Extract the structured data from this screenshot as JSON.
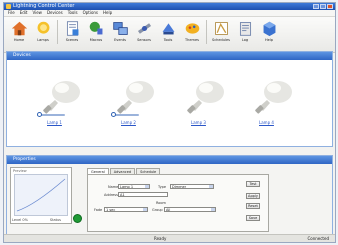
{
  "window": {
    "title": "Lightning Control Center"
  },
  "menu": [
    "File",
    "Edit",
    "View",
    "Devices",
    "Tools",
    "Options",
    "Help"
  ],
  "toolbar": [
    {
      "icon": "house-icon",
      "label": "Home"
    },
    {
      "icon": "light-icon",
      "label": "Lamps"
    },
    {
      "icon": "document-icon",
      "label": "Scenes"
    },
    {
      "icon": "plant-icon",
      "label": "Macros"
    },
    {
      "icon": "network-icon",
      "label": "Events"
    },
    {
      "icon": "satellite-icon",
      "label": "Sensors"
    },
    {
      "icon": "tools-icon",
      "label": "Tools"
    },
    {
      "icon": "palette-icon",
      "label": "Themes"
    },
    {
      "icon": "book-icon",
      "label": "Schedules"
    },
    {
      "icon": "clipboard-icon",
      "label": "Log"
    },
    {
      "icon": "cube-icon",
      "label": "Help"
    }
  ],
  "devices_panel": {
    "title": "Devices"
  },
  "devices": [
    {
      "name": "Lamp 1"
    },
    {
      "name": "Lamp 2"
    },
    {
      "name": "Lamp 3"
    },
    {
      "name": "Lamp 4"
    }
  ],
  "properties_panel": {
    "title": "Properties",
    "preview_label": "Preview",
    "preview_left": "Level 0%",
    "preview_right": "Status",
    "tabs": [
      "General",
      "Advanced",
      "Schedule"
    ],
    "fields": {
      "name_label": "Name",
      "name_value": "Lamp 1",
      "type_label": "Type",
      "type_value": "Dimmer",
      "address_label": "Address",
      "address_value": "A1",
      "room_label": "Room",
      "room_value": "Living",
      "fade_label": "Fade",
      "fade_value": "1 sec",
      "group_label": "Group",
      "group_value": "All",
      "desc_label": "Description",
      "desc_value": ""
    },
    "buttons": [
      "Test",
      "Apply",
      "Reset",
      "Save"
    ]
  },
  "status": {
    "center": "Ready",
    "right": "Connected"
  }
}
